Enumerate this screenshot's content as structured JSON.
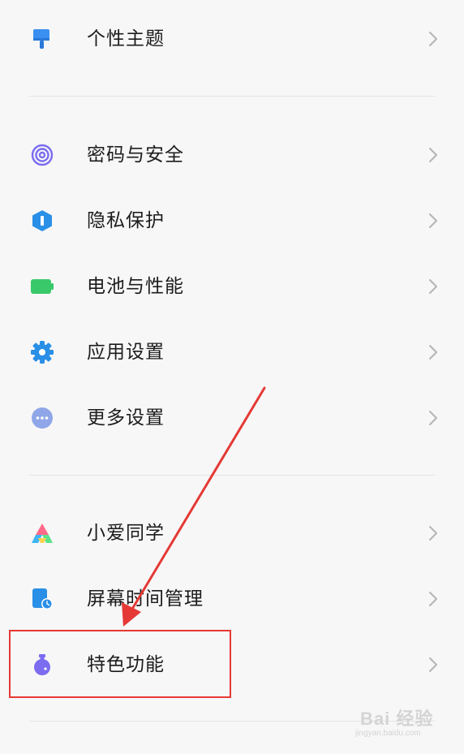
{
  "settings": {
    "items": [
      {
        "label": "个性主题",
        "icon": "paint-brush-icon"
      },
      {
        "label": "密码与安全",
        "icon": "fingerprint-icon"
      },
      {
        "label": "隐私保护",
        "icon": "privacy-shield-icon"
      },
      {
        "label": "电池与性能",
        "icon": "battery-icon"
      },
      {
        "label": "应用设置",
        "icon": "gear-icon"
      },
      {
        "label": "更多设置",
        "icon": "more-dots-icon"
      },
      {
        "label": "小爱同学",
        "icon": "xiaoai-icon"
      },
      {
        "label": "屏幕时间管理",
        "icon": "screen-time-icon"
      },
      {
        "label": "特色功能",
        "icon": "flask-icon"
      }
    ]
  },
  "annotation": {
    "highlight_color": "#e53935"
  },
  "watermark": {
    "main": "Bai 经验",
    "sub": "jingyan.baidu.com"
  },
  "colors": {
    "background": "#f7f7f7",
    "divider": "#e4e4e4",
    "chevron": "#b5b5b5"
  }
}
